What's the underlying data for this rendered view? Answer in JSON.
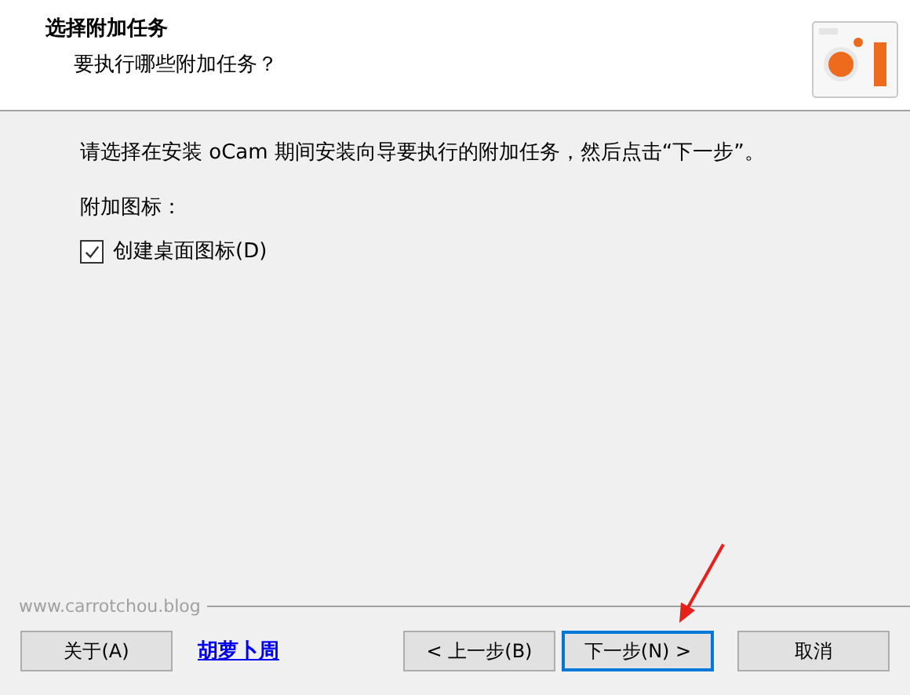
{
  "header": {
    "title": "选择附加任务",
    "subtitle": "要执行哪些附加任务？"
  },
  "intro": "请选择在安装 oCam 期间安装向导要执行的附加任务，然后点击“下一步”。",
  "group_label": "附加图标：",
  "tasks": [
    {
      "label": "创建桌面图标(D)",
      "checked": true
    }
  ],
  "brand": "www.carrotchou.blog",
  "buttons": [
    {
      "kind": "button",
      "label": "关于(A)",
      "default": false
    },
    {
      "kind": "link",
      "label": "胡萝卜周"
    },
    {
      "kind": "button",
      "label": "< 上一步(B)",
      "default": false
    },
    {
      "kind": "button",
      "label": "下一步(N) >",
      "default": true
    },
    {
      "kind": "button",
      "label": "取消",
      "default": false
    }
  ],
  "annotation": {
    "kind": "arrow"
  }
}
